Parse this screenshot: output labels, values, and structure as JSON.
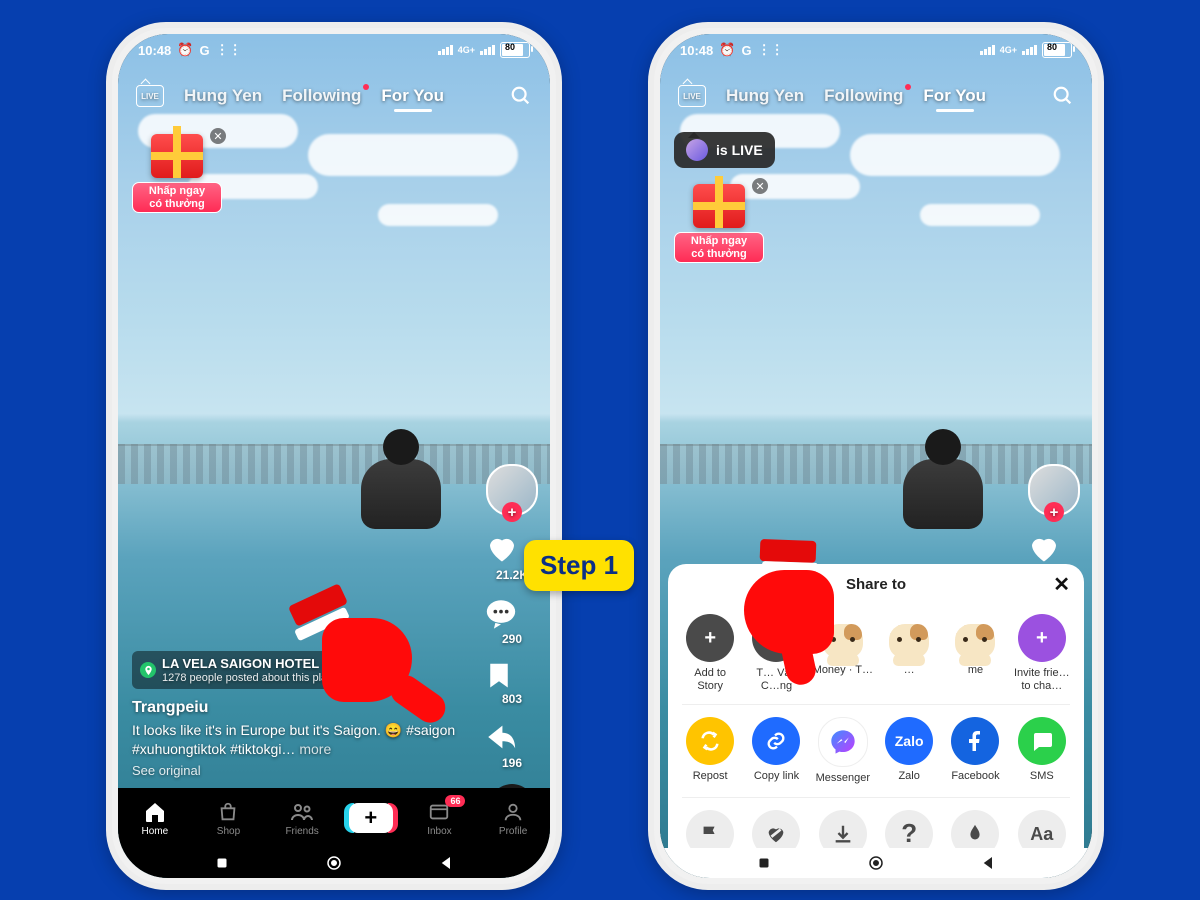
{
  "statusbar": {
    "time": "10:48",
    "network_label": "4G+",
    "battery_pct": "80"
  },
  "top": {
    "tabs": [
      "Hung Yen",
      "Following",
      "For You"
    ],
    "live_label": "LIVE"
  },
  "promo": {
    "line1": "Nhấp ngay",
    "line2": "có thưởng"
  },
  "rail": {
    "likes": "21.2K",
    "comments": "290",
    "saves": "803",
    "shares": "196"
  },
  "caption": {
    "location_name": "LA VELA SAIGON HOTEL · Dis…",
    "location_sub": "1278 people posted about this plac…",
    "username": "Trangpeiu",
    "text": "It looks like it's in Europe but it's Saigon. 😄 #saigon #xuhuongtiktok #tiktokgi…",
    "more": "more",
    "see_original": "See original"
  },
  "nav": {
    "home": "Home",
    "shop": "Shop",
    "friends": "Friends",
    "inbox": "Inbox",
    "inbox_badge": "66",
    "profile": "Profile"
  },
  "step_label": "Step 1",
  "islive_label": "is LIVE",
  "share": {
    "title": "Share to",
    "row_top": [
      {
        "label": "Add to Story"
      },
      {
        "label": "T… Văn C…ng"
      },
      {
        "label": "Money · T…"
      },
      {
        "label": "…"
      },
      {
        "label": "me"
      },
      {
        "label": "Invite frie… to cha…"
      }
    ],
    "row_mid": [
      {
        "label": "Repost"
      },
      {
        "label": "Copy link"
      },
      {
        "label": "Messenger"
      },
      {
        "label": "Zalo"
      },
      {
        "label": "Facebook"
      },
      {
        "label": "SMS"
      }
    ],
    "row_bot": [
      {
        "label": "Report"
      },
      {
        "label": "Not interested"
      },
      {
        "label": "Save video"
      },
      {
        "label": "Why this video"
      },
      {
        "label": "Promote"
      },
      {
        "label": "Captions"
      }
    ]
  }
}
